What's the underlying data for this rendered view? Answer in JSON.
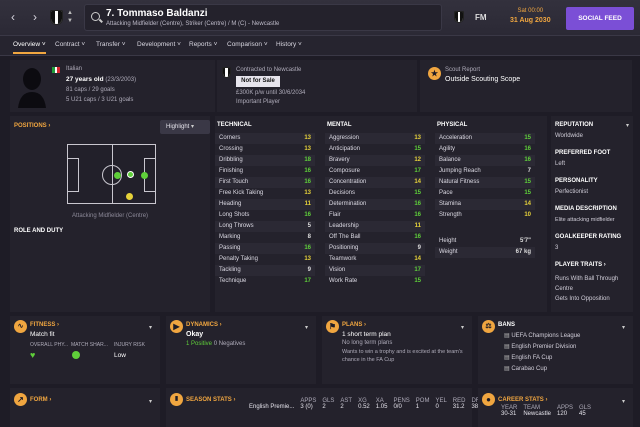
{
  "header": {
    "player_name": "7. Tommaso Baldanzi",
    "player_role": "Attacking Midfielder (Centre), Striker (Centre) / M (C) - Newcastle",
    "fm": "FM",
    "time": "Sat 00:00",
    "date": "31 Aug 2030",
    "social_feed": "SOCIAL FEED"
  },
  "tabs": [
    "Overview",
    "Contract",
    "Transfer",
    "Development",
    "Reports",
    "Comparison",
    "History"
  ],
  "bio": {
    "nationality": "Italian",
    "age": "27 years old",
    "dob": "(23/3/2003)",
    "caps": "81 caps / 29 goals",
    "u21": "5 U21 caps / 3 U21 goals",
    "contract_title": "Contracted to Newcastle",
    "not_for_sale": "Not for Sale",
    "wage": "£300K p/w until 30/6/2034",
    "status": "Important Player",
    "scout_title": "Scout Report",
    "scout_text": "Outside Scouting Scope"
  },
  "positions": {
    "title": "POSITIONS",
    "highlight": "Highlight",
    "caption": "Attacking Midfielder (Centre)",
    "role_duty": "ROLE AND DUTY"
  },
  "technical": {
    "title": "TECHNICAL",
    "items": [
      {
        "name": "Corners",
        "value": "13"
      },
      {
        "name": "Crossing",
        "value": "13"
      },
      {
        "name": "Dribbling",
        "value": "18"
      },
      {
        "name": "Finishing",
        "value": "16"
      },
      {
        "name": "First Touch",
        "value": "16"
      },
      {
        "name": "Free Kick Taking",
        "value": "13"
      },
      {
        "name": "Heading",
        "value": "11"
      },
      {
        "name": "Long Shots",
        "value": "16"
      },
      {
        "name": "Long Throws",
        "value": "5"
      },
      {
        "name": "Marking",
        "value": "8"
      },
      {
        "name": "Passing",
        "value": "16"
      },
      {
        "name": "Penalty Taking",
        "value": "13"
      },
      {
        "name": "Tackling",
        "value": "9"
      },
      {
        "name": "Technique",
        "value": "17"
      }
    ]
  },
  "mental": {
    "title": "MENTAL",
    "items": [
      {
        "name": "Aggression",
        "value": "13"
      },
      {
        "name": "Anticipation",
        "value": "15"
      },
      {
        "name": "Bravery",
        "value": "12"
      },
      {
        "name": "Composure",
        "value": "17"
      },
      {
        "name": "Concentration",
        "value": "14"
      },
      {
        "name": "Decisions",
        "value": "15"
      },
      {
        "name": "Determination",
        "value": "16"
      },
      {
        "name": "Flair",
        "value": "16"
      },
      {
        "name": "Leadership",
        "value": "11"
      },
      {
        "name": "Off The Ball",
        "value": "16"
      },
      {
        "name": "Positioning",
        "value": "9"
      },
      {
        "name": "Teamwork",
        "value": "14"
      },
      {
        "name": "Vision",
        "value": "17"
      },
      {
        "name": "Work Rate",
        "value": "15"
      }
    ]
  },
  "physical": {
    "title": "PHYSICAL",
    "items": [
      {
        "name": "Acceleration",
        "value": "15"
      },
      {
        "name": "Agility",
        "value": "16"
      },
      {
        "name": "Balance",
        "value": "16"
      },
      {
        "name": "Jumping Reach",
        "value": "7"
      },
      {
        "name": "Natural Fitness",
        "value": "15"
      },
      {
        "name": "Pace",
        "value": "15"
      },
      {
        "name": "Stamina",
        "value": "14"
      },
      {
        "name": "Strength",
        "value": "10"
      }
    ],
    "height_label": "Height",
    "height": "5'7\"",
    "weight_label": "Weight",
    "weight": "67 kg"
  },
  "side": {
    "reputation_label": "REPUTATION",
    "reputation": "Worldwide",
    "foot_label": "PREFERRED FOOT",
    "foot": "Left",
    "personality_label": "PERSONALITY",
    "personality": "Perfectionist",
    "media_label": "MEDIA DESCRIPTION",
    "media": "Elite attacking midfielder",
    "rating_label": "GOALKEEPER RATING",
    "rating": "3",
    "traits_label": "PLAYER TRAITS",
    "trait1": "Runs With Ball Through Centre",
    "trait2": "Gets Into Opposition"
  },
  "fitness": {
    "title": "FITNESS",
    "status": "Match fit",
    "col1": "OVERALL PHY...",
    "col2": "MATCH SHAR...",
    "col3": "INJURY RISK",
    "risk": "Low"
  },
  "dynamics": {
    "title": "DYNAMICS",
    "value": "Okay",
    "positive": "1 Positive",
    "negatives": "0 Negatives"
  },
  "plans": {
    "title": "PLANS",
    "line1": "1 short term plan",
    "line2": "No long term plans",
    "line3": "Wants to win a trophy and is excited at the team's chance in the FA Cup"
  },
  "bans": {
    "title": "BANS",
    "items": [
      "UEFA Champions League",
      "English Premier Division",
      "English FA Cup",
      "Carabao Cup"
    ]
  },
  "form": {
    "title": "FORM"
  },
  "season": {
    "title": "SEASON STATS",
    "headers": [
      "APPS",
      "GLS",
      "AST",
      "XG",
      "XA",
      "PENS",
      "POM",
      "YEL",
      "RED",
      "DR...",
      "SH...",
      "PAS...",
      "CLE...",
      "AV RAT"
    ],
    "row": [
      "English Premie...",
      "3 (0)",
      "2",
      "2",
      "0.52",
      "1.05",
      "0/0",
      "1",
      "0",
      "31.2",
      "38%",
      "94%",
      "1.1",
      "7.25"
    ]
  },
  "career": {
    "title": "CAREER STATS",
    "headers": [
      "YEAR",
      "TEAM",
      "APPS",
      "GLS"
    ],
    "row": [
      "30-31",
      "Newcastle",
      "120",
      "45"
    ]
  }
}
